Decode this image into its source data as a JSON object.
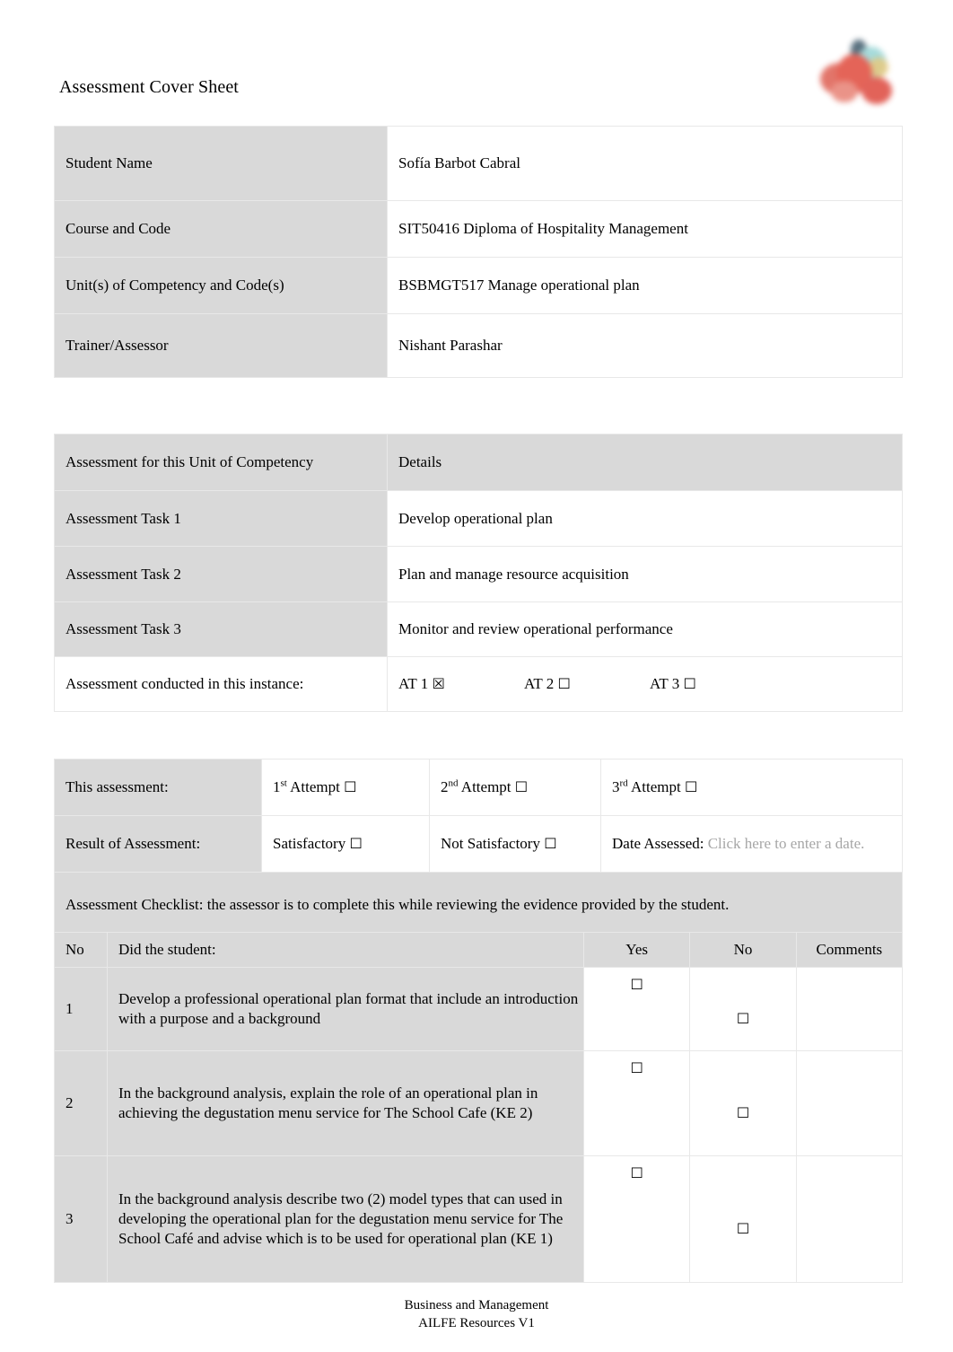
{
  "document": {
    "title": "Assessment Cover Sheet",
    "logo_icon": "organisation-logo-icon"
  },
  "student_details": {
    "rows": [
      {
        "label": "Student Name",
        "value": "Sofía Barbot Cabral"
      },
      {
        "label": "Course and Code",
        "value": "SIT50416 Diploma of Hospitality Management"
      },
      {
        "label": "Unit(s) of Competency and Code(s)",
        "value": "BSBMGT517 Manage operational plan"
      },
      {
        "label": "Trainer/Assessor",
        "value": "Nishant Parashar"
      }
    ]
  },
  "assessment_tasks": {
    "header": {
      "left": "Assessment for this Unit of Competency",
      "right": "Details"
    },
    "rows": [
      {
        "label": "Assessment Task 1",
        "value": "Develop operational plan"
      },
      {
        "label": "Assessment Task 2",
        "value": "Plan and manage resource acquisition"
      },
      {
        "label": "Assessment Task 3",
        "value": "Monitor and review operational performance"
      }
    ],
    "conducted": {
      "label": "Assessment conducted in this instance:",
      "options": [
        {
          "label": "AT 1",
          "checkbox": "☒",
          "checked": true
        },
        {
          "label": "AT 2",
          "checkbox": "☐",
          "checked": false
        },
        {
          "label": "AT 3",
          "checkbox": "☐",
          "checked": false
        }
      ]
    }
  },
  "result": {
    "attempt_label": "This assessment:",
    "attempts": [
      {
        "ordinal": "1",
        "suffix": "st",
        "label": " Attempt ",
        "checkbox": "☐"
      },
      {
        "ordinal": "2",
        "suffix": "nd",
        "label": " Attempt ",
        "checkbox": "☐"
      },
      {
        "ordinal": "3",
        "suffix": "rd",
        "label": " Attempt ",
        "checkbox": "☐"
      }
    ],
    "result_label": "Result of Assessment:",
    "satisfactory": {
      "label": "Satisfactory ",
      "checkbox": "☐"
    },
    "not_satisfactory": {
      "label": "Not Satisfactory ",
      "checkbox": "☐"
    },
    "date_assessed": {
      "label": "Date Assessed:",
      "placeholder": "Click here to enter a date."
    },
    "checklist_banner": "Assessment Checklist: the assessor is to complete this while reviewing the evidence provided by the student."
  },
  "checklist": {
    "headers": {
      "no": "No",
      "question": "Did the student:",
      "yes": "Yes",
      "no_col": "No",
      "comments": "Comments"
    },
    "rows": [
      {
        "no": "1",
        "question": "Develop  a professional operational plan format that include an introduction with a purpose and a background",
        "yes": "☐",
        "no_answer": "☐",
        "comments": ""
      },
      {
        "no": "2",
        "question": "In the background analysis, explain the role of an operational plan in achieving the degustation menu service for The School Cafe (KE 2)",
        "yes": "☐",
        "no_answer": "☐",
        "comments": ""
      },
      {
        "no": "3",
        "question": "In the background analysis describe two (2) model types that can used in developing the operational plan for the degustation menu service for The School Café and advise which is to be used for operational plan (KE 1)",
        "yes": "☐",
        "no_answer": "☐",
        "comments": ""
      }
    ]
  },
  "footer": {
    "line1": "Business and Management",
    "line2": "AILFE Resources V1"
  }
}
